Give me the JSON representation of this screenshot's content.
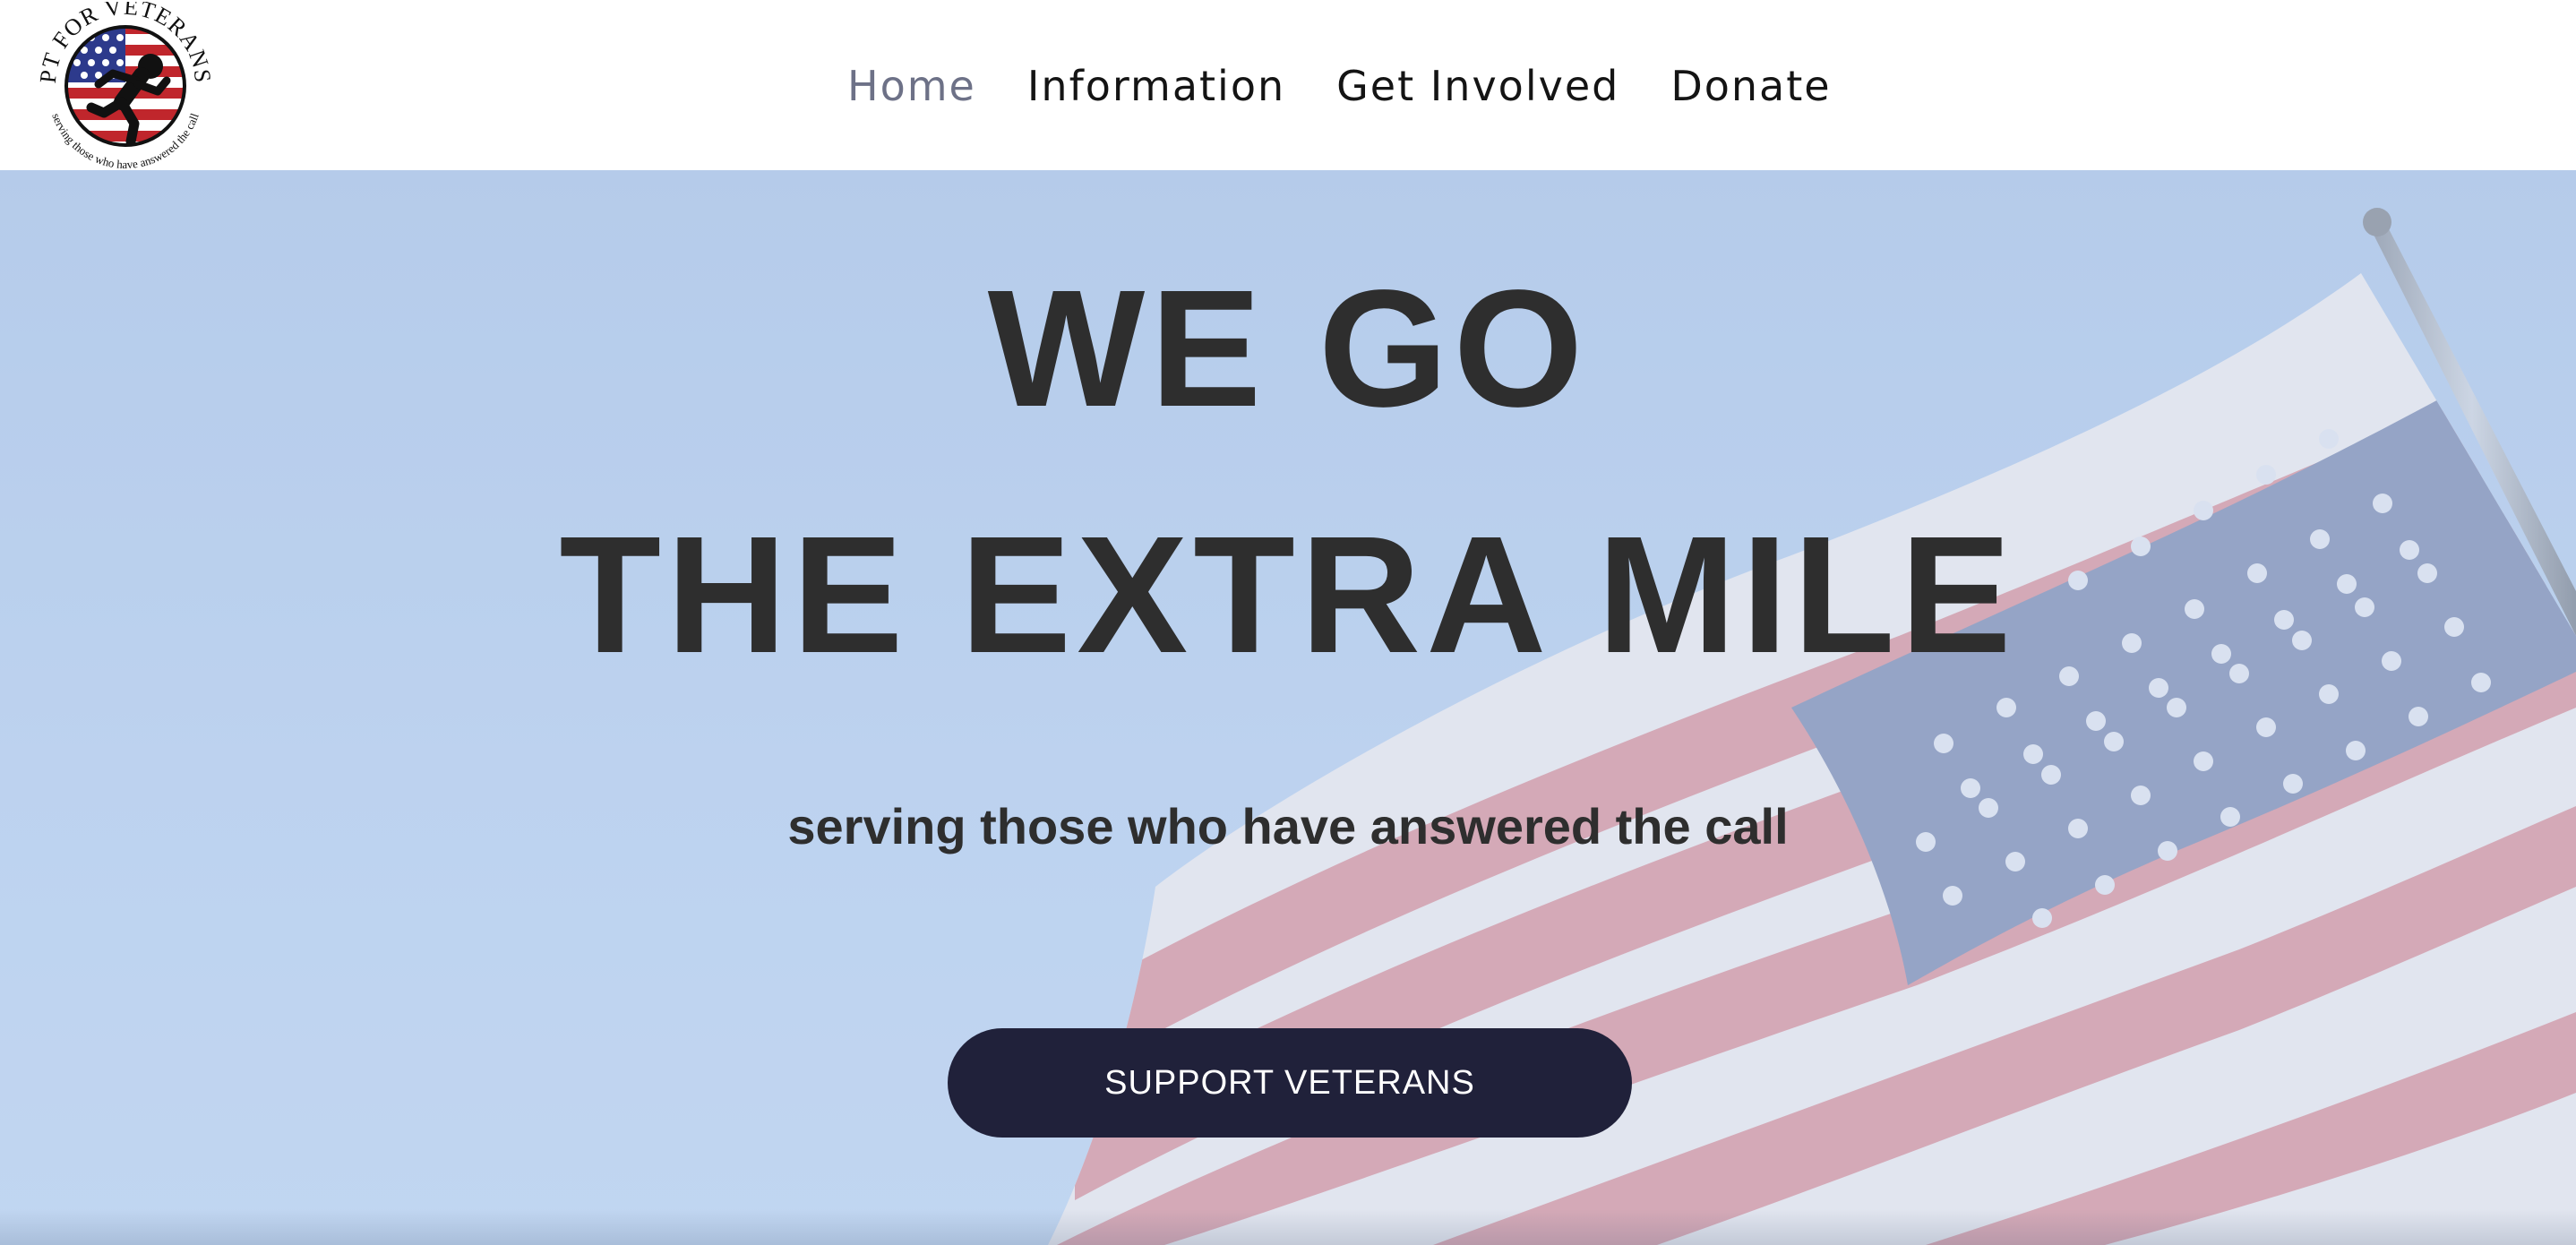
{
  "logo": {
    "top_text": "PT FOR VETERANS",
    "bottom_text": "serving those who have answered the call",
    "icon": "running-figure-flag-logo"
  },
  "nav": {
    "items": [
      {
        "label": "Home",
        "active": true
      },
      {
        "label": "Information",
        "active": false
      },
      {
        "label": "Get Involved",
        "active": false
      },
      {
        "label": "Donate",
        "active": false
      }
    ]
  },
  "hero": {
    "headline_line1": "WE GO",
    "headline_line2": "THE EXTRA MILE",
    "tagline": "serving those who have answered the call",
    "cta_label": "SUPPORT VETERANS",
    "background": "american-flag-waving"
  },
  "colors": {
    "nav_text": "#141414",
    "nav_active": "#6d7187",
    "headline": "#2e2e2e",
    "cta_bg": "#20213a",
    "cta_text": "#ffffff",
    "sky": "#b7cdee"
  }
}
